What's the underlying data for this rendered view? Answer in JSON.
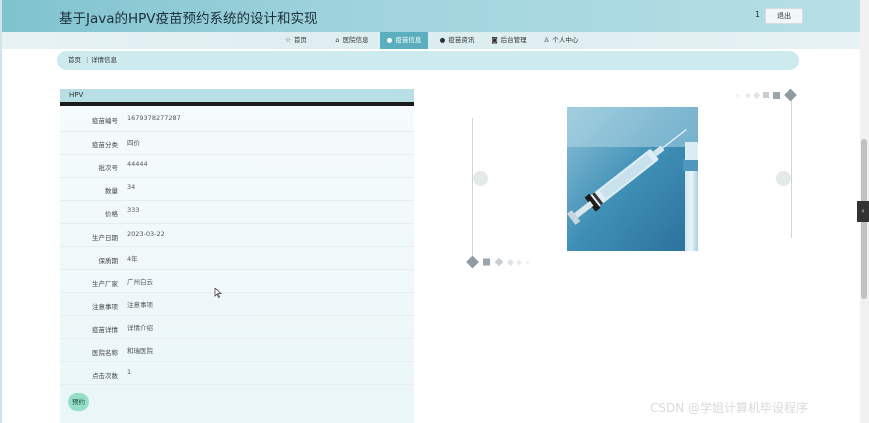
{
  "header": {
    "title": "基于Java的HPV疫苗预约系统的设计和实现",
    "user_number": "1",
    "logout_label": "退出"
  },
  "nav": {
    "items": [
      {
        "label": "首页",
        "icon": "star-icon",
        "glyph": "☆"
      },
      {
        "label": "医院信息",
        "icon": "home-icon",
        "glyph": "⌂"
      },
      {
        "label": "疫苗信息",
        "icon": "info-icon",
        "glyph": "●"
      },
      {
        "label": "疫苗资讯",
        "icon": "question-icon",
        "glyph": "●"
      },
      {
        "label": "后台管理",
        "icon": "camera-icon",
        "glyph": "◙"
      },
      {
        "label": "个人中心",
        "icon": "user-icon",
        "glyph": "♙"
      }
    ],
    "active_index": 2
  },
  "breadcrumb": {
    "home": "首页",
    "separator": "⋮",
    "current": "详情信息"
  },
  "detail": {
    "title": "HPV",
    "fields": [
      {
        "label": "疫苗编号",
        "value": "1679378277287"
      },
      {
        "label": "疫苗分类",
        "value": "四价"
      },
      {
        "label": "批次号",
        "value": "44444"
      },
      {
        "label": "数量",
        "value": "34"
      },
      {
        "label": "价格",
        "value": "333"
      },
      {
        "label": "生产日期",
        "value": "2023-03-22"
      },
      {
        "label": "保质期",
        "value": "4年"
      },
      {
        "label": "生产厂家",
        "value": "广州白云"
      },
      {
        "label": "注意事项",
        "value": "注意事项"
      },
      {
        "label": "疫苗详情",
        "value": "详情介绍"
      },
      {
        "label": "医院名称",
        "value": "和瑞医院"
      },
      {
        "label": "点击次数",
        "value": "1"
      }
    ],
    "book_label": "预约"
  },
  "side_tab": {
    "glyph": "‹"
  },
  "watermark": "CSDN @学姐计算机毕设程序",
  "colors": {
    "header_start": "#7fc3cf",
    "header_end": "#b7dfe6",
    "nav_active": "#5aaebe",
    "breadcrumb_bg": "#cdeaef",
    "book_button": "#94e0c7"
  }
}
